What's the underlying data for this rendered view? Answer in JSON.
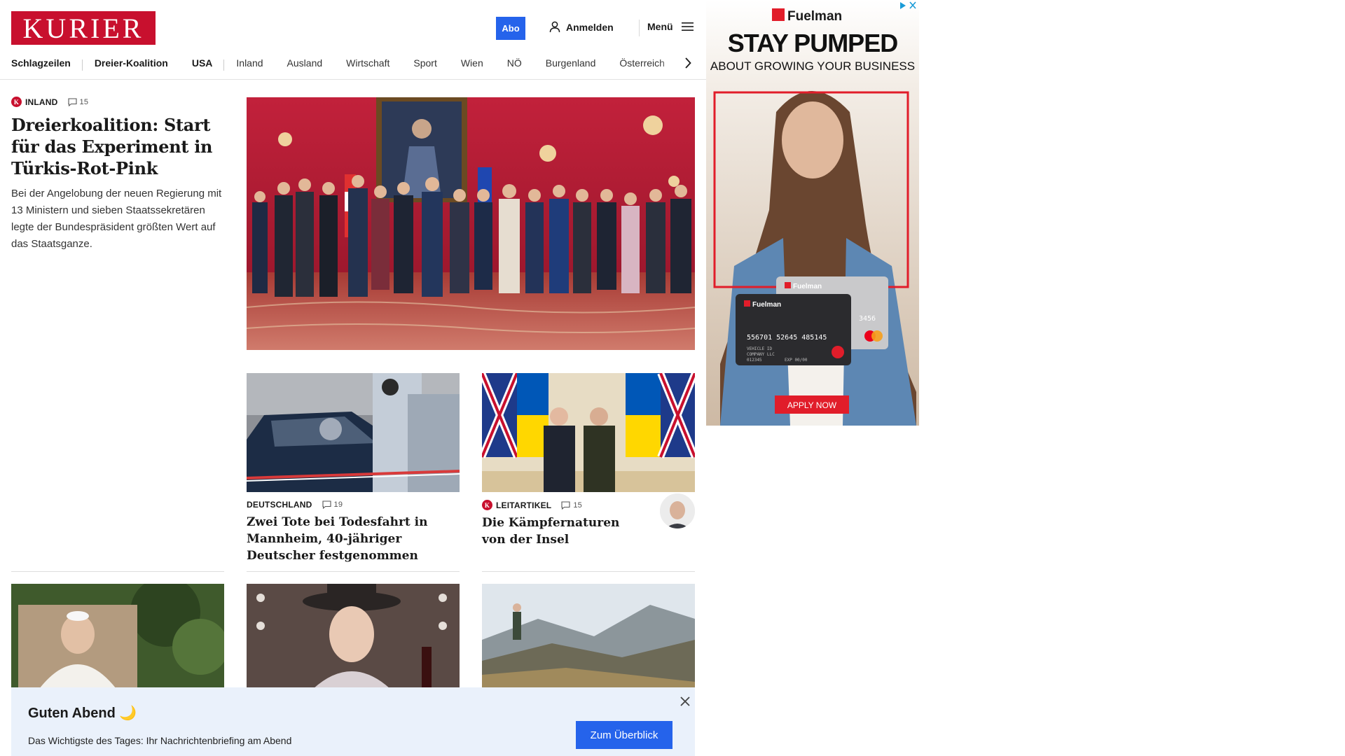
{
  "header": {
    "logo_text": "KURIER",
    "abo_label": "Abo",
    "login_label": "Anmelden",
    "menu_label": "Menü"
  },
  "nav": {
    "items": [
      "Schlagzeilen",
      "Dreier-Koalition",
      "USA",
      "Inland",
      "Ausland",
      "Wirtschaft",
      "Sport",
      "Wien",
      "NÖ",
      "Burgenland",
      "Österreich"
    ]
  },
  "lead": {
    "section": "INLAND",
    "comments": "15",
    "title": "Dreierkoalition: Start für das Experiment in Türkis-Rot-Pink",
    "teaser": "Bei der Angelobung der neuen Regierung mit 13 Ministern und sieben Staatssekretären legte der Bundespräsident größten Wert auf das Staatsganze."
  },
  "articles": [
    {
      "section": "DEUTSCHLAND",
      "comments": "19",
      "title": "Zwei Tote bei Todesfahrt in Mannheim, 40-jähriger Deutscher festgenommen"
    },
    {
      "section": "LEITARTIKEL",
      "comments": "15",
      "title": "Die Kämpfernaturen von der Insel"
    }
  ],
  "ad": {
    "brand": "Fuelman",
    "headline": "STAY PUMPED",
    "subline": "ABOUT GROWING YOUR BUSINESS",
    "card_number": "556701 52645 485145",
    "card_label": "Fuelman",
    "card_back_digits": "3456",
    "card_vehicle": "VEHICLE ID",
    "card_company": "COMPANY LLC",
    "card_id": "012345",
    "card_exp": "EXP 00/00",
    "cta": "APPLY NOW"
  },
  "banner": {
    "title": "Guten Abend 🌙",
    "text": "Das Wichtigste des Tages: Ihr Nachrichtenbriefing am Abend",
    "button": "Zum Überblick"
  },
  "colors": {
    "brand_red": "#c8102e",
    "accent_blue": "#2563eb",
    "banner_bg": "#eaf1fb"
  }
}
